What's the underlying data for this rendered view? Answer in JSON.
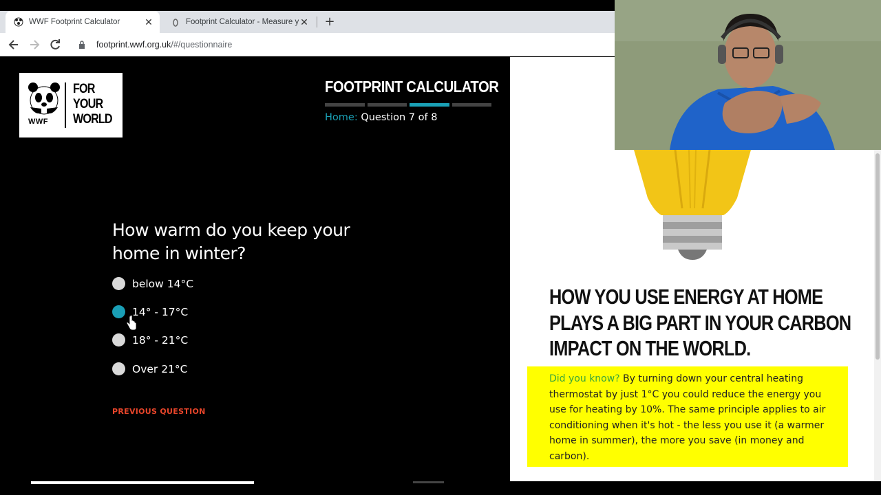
{
  "browser": {
    "tabs": [
      {
        "title": "WWF Footprint Calculator",
        "active": true
      },
      {
        "title": "Footprint Calculator - Measure y",
        "active": false
      }
    ],
    "url_host": "footprint.wwf.org.uk",
    "url_path": "/#/questionnaire"
  },
  "logo": {
    "wwf": "WWF",
    "tagline_line1": "FOR",
    "tagline_line2": "YOUR",
    "tagline_line3": "WORLD"
  },
  "header": {
    "title": "FOOTPRINT CALCULATOR",
    "progress_segments": 4,
    "progress_active_index": 2,
    "breadcrumb_home": "Home:",
    "breadcrumb_step": "Question 7 of 8"
  },
  "question": {
    "text": "How warm do you keep your home in winter?",
    "options": [
      {
        "label": "below 14°C",
        "selected": false
      },
      {
        "label": "14° - 17°C",
        "selected": true
      },
      {
        "label": "18° - 21°C",
        "selected": false
      },
      {
        "label": "Over 21°C",
        "selected": false
      }
    ],
    "previous_label": "PREVIOUS QUESTION"
  },
  "info": {
    "heading_line1": "HOW YOU USE ENERGY AT HOME",
    "heading_line2": "PLAYS A BIG PART IN YOUR CARBON",
    "heading_line3": "IMPACT ON THE WORLD.",
    "did_you_know": "Did you know?",
    "fact": " By turning down your central heating thermostat by just 1°C you could reduce the energy you use for heating by 10%. The same principle applies to air conditioning when it's hot - the less you use it (a warmer home in summer), the more you save (in money and carbon)."
  },
  "colors": {
    "accent": "#1aa1b6",
    "prev_link": "#e8452a",
    "fact_bg": "#ffff00",
    "did_you_know": "#3aa63a"
  }
}
